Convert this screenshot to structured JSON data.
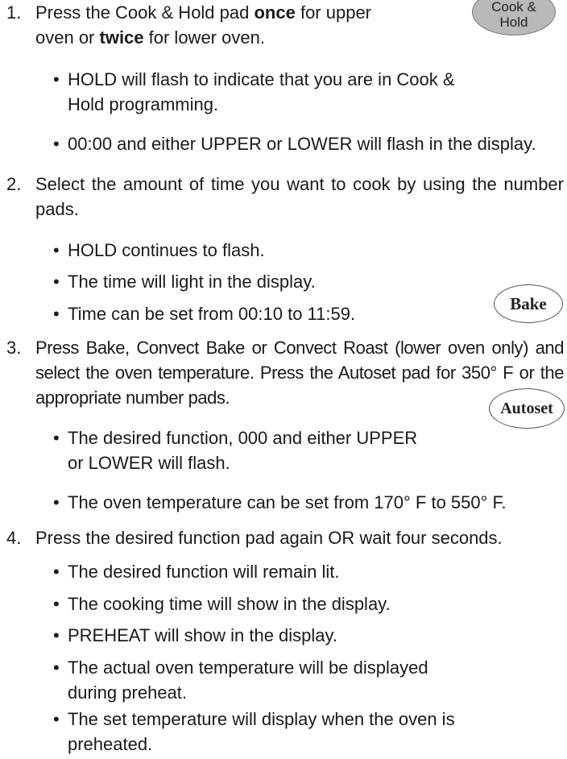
{
  "pads": {
    "cook_hold": "Cook &\nHold",
    "bake": "Bake",
    "autoset": "Autoset"
  },
  "steps": [
    {
      "num": "1.",
      "pre": "Press the Cook & Hold pad ",
      "b1": "once",
      "mid": " for upper",
      "line2_pre": "oven or ",
      "b2": "twice",
      "line2_post": " for lower oven.",
      "bullets": [
        "HOLD will flash to indicate that you are in Cook & Hold programming.",
        "00:00 and either UPPER or LOWER will flash in the display."
      ]
    },
    {
      "num": "2.",
      "text": "Select the amount of time you want to cook by using the number pads.",
      "bullets": [
        "HOLD continues to flash.",
        "The time will light in the display.",
        "Time can be set from 00:10 to 11:59."
      ]
    },
    {
      "num": "3.",
      "text": "Press Bake, Convect Bake or Convect Roast (lower oven only) and select the oven temperature. Press the Autoset pad for 350° F or the appropriate number pads.",
      "bullets": [
        "The desired function, 000 and either UPPER or LOWER will flash.",
        "The oven temperature can be set from 170° F to 550° F."
      ]
    },
    {
      "num": "4.",
      "text": "Press the desired function pad again OR wait four seconds.",
      "bullets": [
        "The desired function will remain lit.",
        "The cooking time will show in the display.",
        "PREHEAT will show in the display.",
        "The actual oven temperature will be displayed during preheat.",
        "The set temperature will display when the oven is preheated."
      ]
    }
  ],
  "bullet_symbol": "•"
}
